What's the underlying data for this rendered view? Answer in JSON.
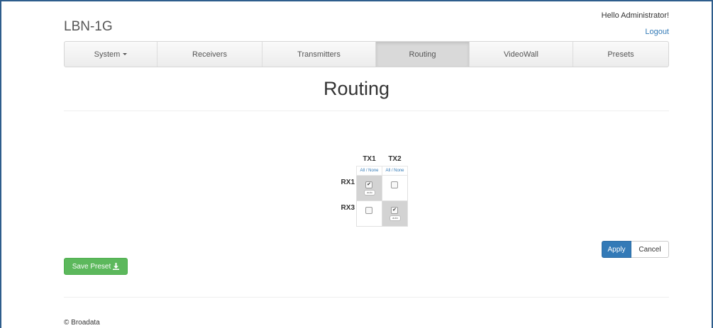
{
  "brand": "LBN-1G",
  "header": {
    "greeting": "Hello Administrator!",
    "logout": "Logout"
  },
  "nav": {
    "items": [
      {
        "label": "System"
      },
      {
        "label": "Receivers"
      },
      {
        "label": "Transmitters"
      },
      {
        "label": "Routing",
        "active": true
      },
      {
        "label": "VideoWall"
      },
      {
        "label": "Presets"
      }
    ]
  },
  "page": {
    "title": "Routing"
  },
  "matrix": {
    "columns": [
      "TX1",
      "TX2"
    ],
    "all_none": "All / None",
    "rows": [
      {
        "label": "RX1",
        "routes": [
          true,
          false
        ]
      },
      {
        "label": "RX3",
        "routes": [
          false,
          true
        ]
      }
    ],
    "badge": "auto"
  },
  "actions": {
    "apply": "Apply",
    "cancel": "Cancel",
    "save_preset": "Save Preset"
  },
  "footer": "© Broadata",
  "colors": {
    "primary": "#337ab7",
    "success": "#5cb85c",
    "frame": "#2e5d8c"
  }
}
